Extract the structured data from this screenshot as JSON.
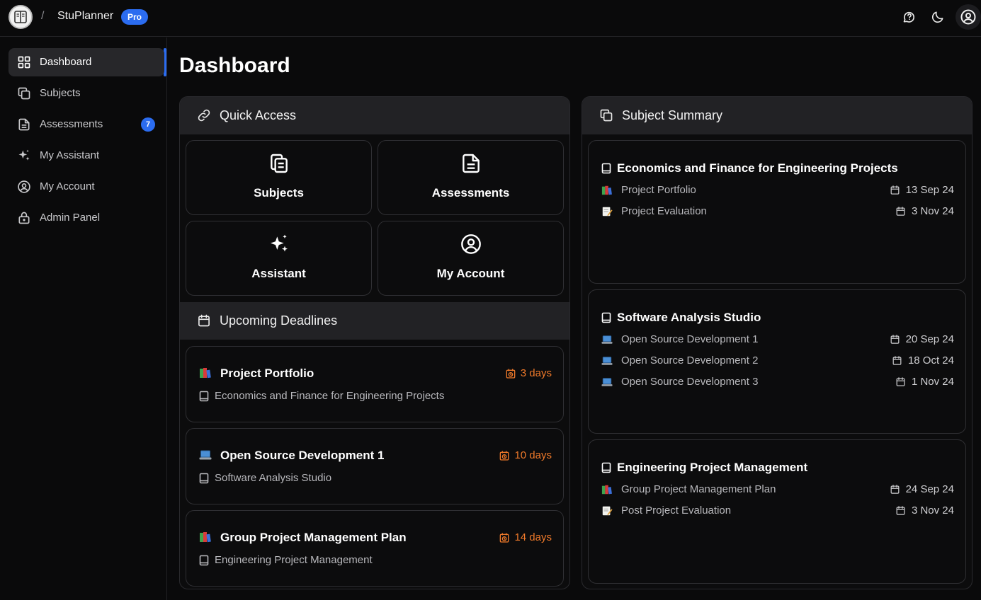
{
  "header": {
    "separator": "/",
    "brand": "StuPlanner",
    "plan_badge": "Pro",
    "icons": [
      "chat-icon",
      "moon-icon",
      "user-circle-icon"
    ]
  },
  "sidebar": {
    "items": [
      {
        "label": "Dashboard",
        "icon": "grid-icon",
        "active": true
      },
      {
        "label": "Subjects",
        "icon": "copy-icon"
      },
      {
        "label": "Assessments",
        "icon": "document-icon",
        "badge": "7"
      },
      {
        "label": "My Assistant",
        "icon": "sparkles-icon"
      },
      {
        "label": "My Account",
        "icon": "user-circle-icon"
      },
      {
        "label": "Admin Panel",
        "icon": "lock-icon"
      }
    ]
  },
  "main": {
    "title": "Dashboard",
    "quick_access": {
      "title": "Quick Access",
      "cards": [
        {
          "label": "Subjects",
          "icon": "copy-icon"
        },
        {
          "label": "Assessments",
          "icon": "document-icon"
        },
        {
          "label": "Assistant",
          "icon": "sparkles-icon"
        },
        {
          "label": "My Account",
          "icon": "user-circle-icon"
        }
      ]
    },
    "upcoming_deadlines": {
      "title": "Upcoming Deadlines",
      "items": [
        {
          "emoji": "books",
          "title": "Project Portfolio",
          "due": "3 days",
          "subject": "Economics and Finance for Engineering Projects"
        },
        {
          "emoji": "laptop",
          "title": "Open Source Development 1",
          "due": "10 days",
          "subject": "Software Analysis Studio"
        },
        {
          "emoji": "books",
          "title": "Group Project Management Plan",
          "due": "14 days",
          "subject": "Engineering Project Management"
        }
      ]
    },
    "subject_summary": {
      "title": "Subject Summary",
      "subjects": [
        {
          "name": "Economics and Finance for Engineering Projects",
          "assessments": [
            {
              "emoji": "books",
              "name": "Project Portfolio",
              "date": "13 Sep 24"
            },
            {
              "emoji": "memo",
              "name": "Project Evaluation",
              "date": "3 Nov 24"
            }
          ]
        },
        {
          "name": "Software Analysis Studio",
          "assessments": [
            {
              "emoji": "laptop",
              "name": "Open Source Development 1",
              "date": "20 Sep 24"
            },
            {
              "emoji": "laptop",
              "name": "Open Source Development 2",
              "date": "18 Oct 24"
            },
            {
              "emoji": "laptop",
              "name": "Open Source Development 3",
              "date": "1 Nov 24"
            }
          ]
        },
        {
          "name": "Engineering Project Management",
          "assessments": [
            {
              "emoji": "books",
              "name": "Group Project Management Plan",
              "date": "24 Sep 24"
            },
            {
              "emoji": "memo",
              "name": "Post Project Evaluation",
              "date": "3 Nov 24"
            }
          ]
        }
      ]
    }
  },
  "colors": {
    "accent": "#2b6cf0",
    "due": "#f07a2a",
    "background": "#0a0a0b",
    "panel_header": "#222225"
  }
}
